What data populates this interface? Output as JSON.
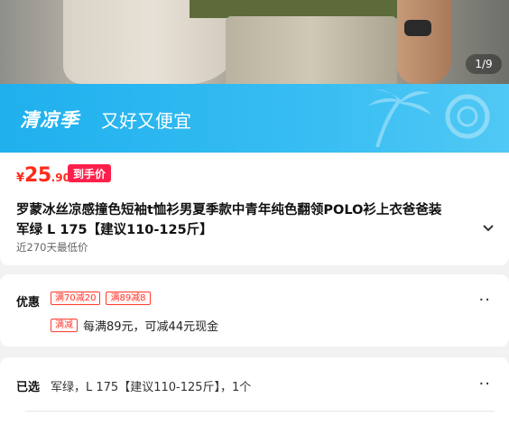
{
  "gallery": {
    "counter": "1/9"
  },
  "banner": {
    "title": "清凉季",
    "subtitle": "又好又便宜"
  },
  "price": {
    "currency": "¥",
    "integer": "25",
    "decimal": ".90",
    "tag": "到手价"
  },
  "product": {
    "title_line1": "罗蒙冰丝凉感撞色短袖t恤衫男夏季款中青年纯色翻领POLO衫上衣爸爸装",
    "title_line2": "军绿 L 175【建议110-125斤】",
    "low_price_note": "近270天最低价"
  },
  "promotions": {
    "label": "优惠",
    "coupons": [
      "满70减20",
      "满89减8"
    ],
    "badge": "满减",
    "detail": "每满89元，可减44元现金"
  },
  "selection": {
    "label": "已选",
    "value": "军绿，L 175【建议110-125斤】，1个"
  },
  "icons": {
    "more": "more-dots-icon",
    "expand": "chevron-down-icon"
  },
  "colors": {
    "accent_red": "#ff2a1a",
    "banner_blue": "#1fb0ee"
  }
}
